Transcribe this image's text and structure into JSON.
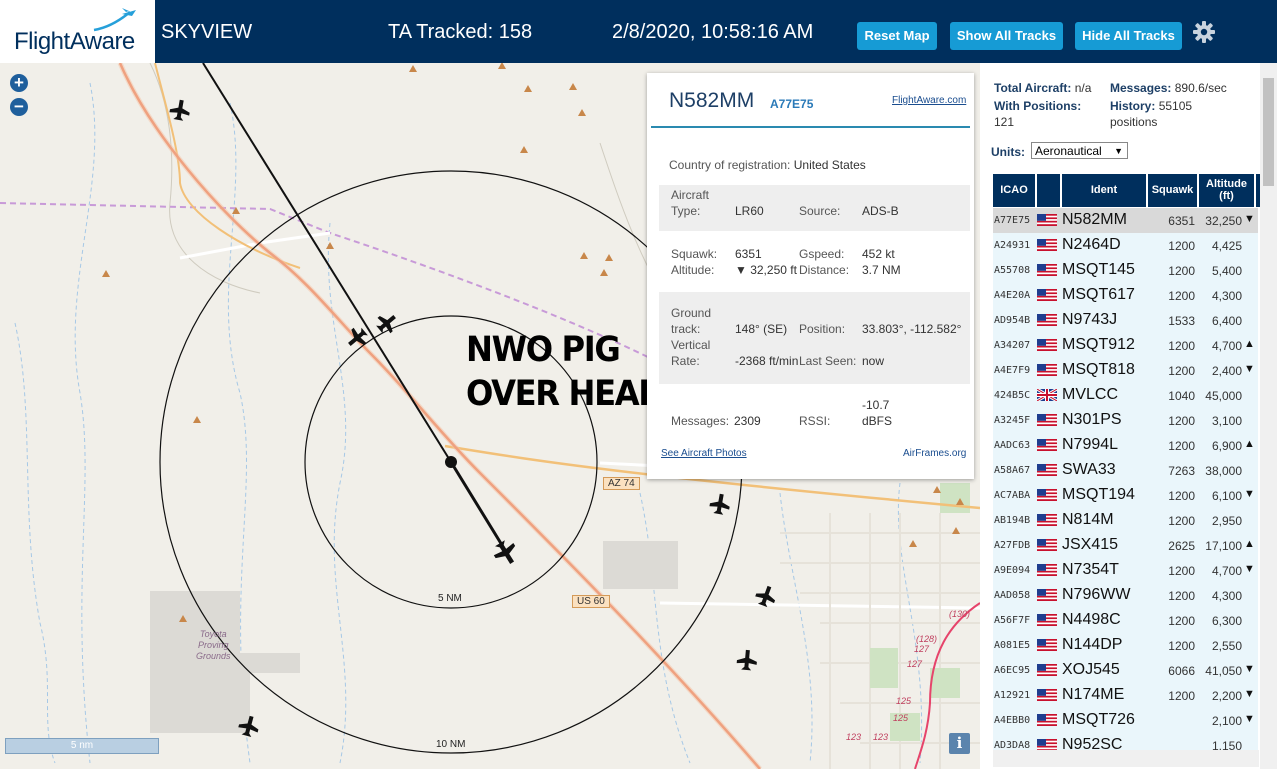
{
  "header": {
    "logo": "FlightAware",
    "app_title": "SKYVIEW",
    "tracked": "TA Tracked: 158",
    "datetime": "2/8/2020, 10:58:16 AM",
    "reset_label": "Reset Map",
    "show_label": "Show All Tracks",
    "hide_label": "Hide All Tracks",
    "gear_icon": "gear-icon",
    "colors": {
      "bar": "#002f5d",
      "button": "#169bd5"
    }
  },
  "map": {
    "zoom_in": "+",
    "zoom_out": "−",
    "annotation_line1": "NWO PIG",
    "annotation_line2": "OVER HEAD",
    "ring_5": "5 NM",
    "ring_10": "10 NM",
    "road_az74": "AZ 74",
    "road_us60": "US 60",
    "place_label": "Toyota\nProving\nGrounds",
    "route_130": "(130)",
    "route_128": "(128)",
    "n127a": "127",
    "n127b": "127",
    "n125a": "125",
    "n125b": "125",
    "n123": "123",
    "n123b": "123",
    "scale_label": "5 nm",
    "info_label": "i"
  },
  "popup": {
    "ident": "N582MM",
    "hex": "A77E75",
    "link": "FlightAware.com",
    "country_label": "Country of registration:",
    "country": "United States",
    "type_label1": "Aircraft",
    "type_label2": "Type:",
    "type": "LR60",
    "source_label": "Source:",
    "source": "ADS-B",
    "squawk_label": "Squawk:",
    "squawk": "6351",
    "gspeed_label": "Gspeed:",
    "gspeed": "452 kt",
    "altitude_label": "Altitude:",
    "altitude": "▼ 32,250 ft",
    "distance_label": "Distance:",
    "distance": "3.7 NM",
    "track_label1": "Ground",
    "track_label2": "track:",
    "track": "148° (SE)",
    "position_label": "Position:",
    "position": "33.803°, -112.582°",
    "vrate_label1": "Vertical",
    "vrate_label2": "Rate:",
    "vrate": "-2368 ft/min",
    "lastseen_label": "Last Seen:",
    "lastseen": "now",
    "messages_label": "Messages:",
    "messages": "2309",
    "rssi_label": "RSSI:",
    "rssi1": "-10.7",
    "rssi2": "dBFS",
    "photos_link": "See Aircraft Photos",
    "airframes_link": "AirFrames.org"
  },
  "stats": {
    "total_label": "Total Aircraft:",
    "total": "n/a",
    "messages_label": "Messages:",
    "messages": "890.6/sec",
    "positions_label": "With Positions:",
    "positions": "121",
    "history_label": "History:",
    "history": "55105",
    "history_unit": "positions",
    "units_label": "Units:",
    "units_value": "Aeronautical"
  },
  "table": {
    "headers": {
      "icao": "ICAO",
      "ident": "Ident",
      "squawk": "Squawk",
      "altitude": "Altitude\n(ft)"
    },
    "rows": [
      {
        "icao": "A77E75",
        "flag": "us",
        "ident": "N582MM",
        "squawk": "6351",
        "alt": "32,250",
        "arrow": "▼"
      },
      {
        "icao": "A24931",
        "flag": "us",
        "ident": "N2464D",
        "squawk": "1200",
        "alt": "4,425",
        "arrow": ""
      },
      {
        "icao": "A55708",
        "flag": "us",
        "ident": "MSQT145",
        "squawk": "1200",
        "alt": "5,400",
        "arrow": ""
      },
      {
        "icao": "A4E20A",
        "flag": "us",
        "ident": "MSQT617",
        "squawk": "1200",
        "alt": "4,300",
        "arrow": ""
      },
      {
        "icao": "AD954B",
        "flag": "us",
        "ident": "N9743J",
        "squawk": "1533",
        "alt": "6,400",
        "arrow": ""
      },
      {
        "icao": "A34207",
        "flag": "us",
        "ident": "MSQT912",
        "squawk": "1200",
        "alt": "4,700",
        "arrow": "▲"
      },
      {
        "icao": "A4E7F9",
        "flag": "us",
        "ident": "MSQT818",
        "squawk": "1200",
        "alt": "2,400",
        "arrow": "▼"
      },
      {
        "icao": "424B5C",
        "flag": "uk",
        "ident": "MVLCC",
        "squawk": "1040",
        "alt": "45,000",
        "arrow": ""
      },
      {
        "icao": "A3245F",
        "flag": "us",
        "ident": "N301PS",
        "squawk": "1200",
        "alt": "3,100",
        "arrow": ""
      },
      {
        "icao": "AADC63",
        "flag": "us",
        "ident": "N7994L",
        "squawk": "1200",
        "alt": "6,900",
        "arrow": "▲"
      },
      {
        "icao": "A58A67",
        "flag": "us",
        "ident": "SWA33",
        "squawk": "7263",
        "alt": "38,000",
        "arrow": ""
      },
      {
        "icao": "AC7ABA",
        "flag": "us",
        "ident": "MSQT194",
        "squawk": "1200",
        "alt": "6,100",
        "arrow": "▼"
      },
      {
        "icao": "AB194B",
        "flag": "us",
        "ident": "N814M",
        "squawk": "1200",
        "alt": "2,950",
        "arrow": ""
      },
      {
        "icao": "A27FDB",
        "flag": "us",
        "ident": "JSX415",
        "squawk": "2625",
        "alt": "17,100",
        "arrow": "▲"
      },
      {
        "icao": "A9E094",
        "flag": "us",
        "ident": "N7354T",
        "squawk": "1200",
        "alt": "4,700",
        "arrow": "▼"
      },
      {
        "icao": "AAD058",
        "flag": "us",
        "ident": "N796WW",
        "squawk": "1200",
        "alt": "4,300",
        "arrow": ""
      },
      {
        "icao": "A56F7F",
        "flag": "us",
        "ident": "N4498C",
        "squawk": "1200",
        "alt": "6,300",
        "arrow": ""
      },
      {
        "icao": "A081E5",
        "flag": "us",
        "ident": "N144DP",
        "squawk": "1200",
        "alt": "2,550",
        "arrow": ""
      },
      {
        "icao": "A6EC95",
        "flag": "us",
        "ident": "XOJ545",
        "squawk": "6066",
        "alt": "41,050",
        "arrow": "▼"
      },
      {
        "icao": "A12921",
        "flag": "us",
        "ident": "N174ME",
        "squawk": "1200",
        "alt": "2,200",
        "arrow": "▼"
      },
      {
        "icao": "A4EBB0",
        "flag": "us",
        "ident": "MSQT726",
        "squawk": "",
        "alt": "2,100",
        "arrow": "▼"
      },
      {
        "icao": "AD3DA8",
        "flag": "us",
        "ident": "N952SC",
        "squawk": "",
        "alt": "1,150",
        "arrow": ""
      }
    ]
  }
}
